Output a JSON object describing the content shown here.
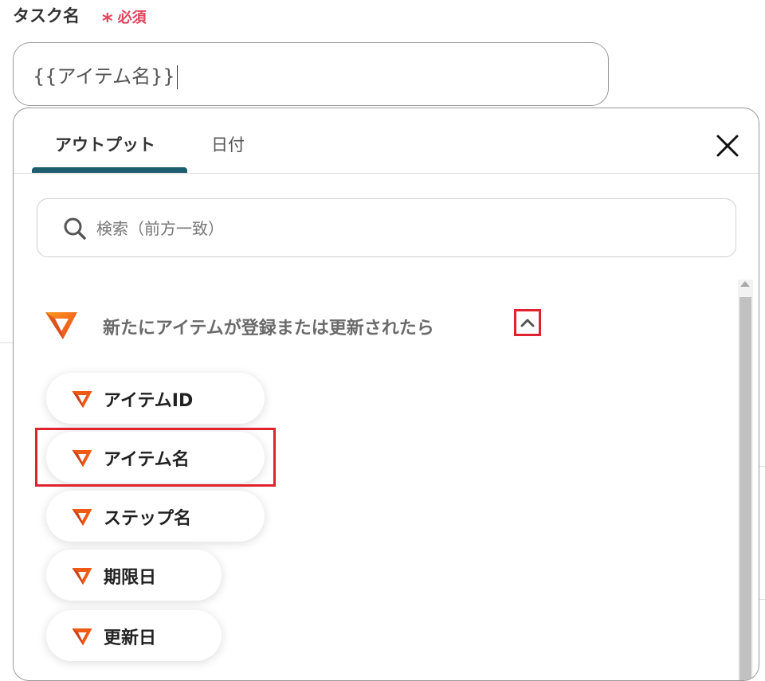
{
  "field": {
    "label": "タスク名",
    "required_mark": "*",
    "required_text": "必須",
    "value": "{{アイテム名}}"
  },
  "panel": {
    "tabs": [
      {
        "label": "アウトプット",
        "active": true
      },
      {
        "label": "日付",
        "active": false
      }
    ],
    "search": {
      "placeholder": "検索（前方一致）"
    },
    "group": {
      "title": "新たにアイテムが登録または更新されたら",
      "expanded": true
    },
    "items": [
      {
        "label": "アイテムID"
      },
      {
        "label": "アイテム名",
        "highlighted": true
      },
      {
        "label": "ステップ名"
      },
      {
        "label": "期限日"
      },
      {
        "label": "更新日"
      }
    ]
  },
  "colors": {
    "accent": "#1d5e6e",
    "required": "#e5445c",
    "highlight": "#e0222c",
    "logo_orange": "#f05a14"
  },
  "icons": [
    "close-icon",
    "search-icon",
    "chevron-up-icon",
    "app-logo-icon"
  ]
}
